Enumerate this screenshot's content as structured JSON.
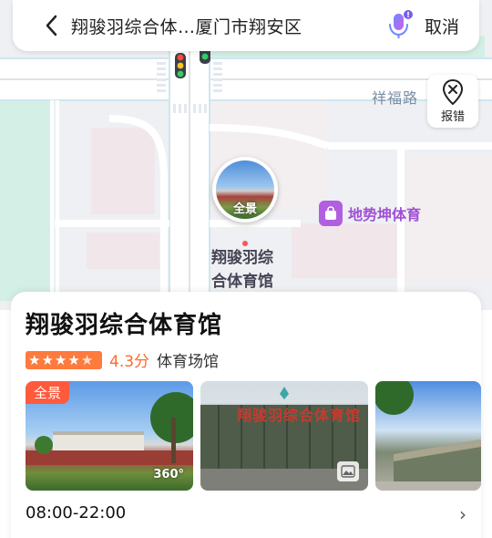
{
  "search": {
    "query": "翔骏羽综合体…厦门市翔安区",
    "cancel_label": "取消"
  },
  "map": {
    "road_label": "祥福路",
    "report_label": "报错",
    "panorama_label": "全景",
    "place_label_line1": "翔骏羽综",
    "place_label_line2": "合体育馆",
    "poi_label": "地势坤体育"
  },
  "card": {
    "title": "翔骏羽综合体育馆",
    "rating": "4.3分",
    "rating_value": 4.3,
    "category": "体育场馆",
    "photo_pano_tag": "全景",
    "photo_360_label": "360°",
    "building_sign_text": "翔骏羽综合体育馆",
    "hours": "08:00-22:00",
    "chevron": "›"
  },
  "colors": {
    "accent_orange": "#ff6a2b",
    "poi_purple": "#a04fd6",
    "road_label": "#7a8ea5"
  }
}
